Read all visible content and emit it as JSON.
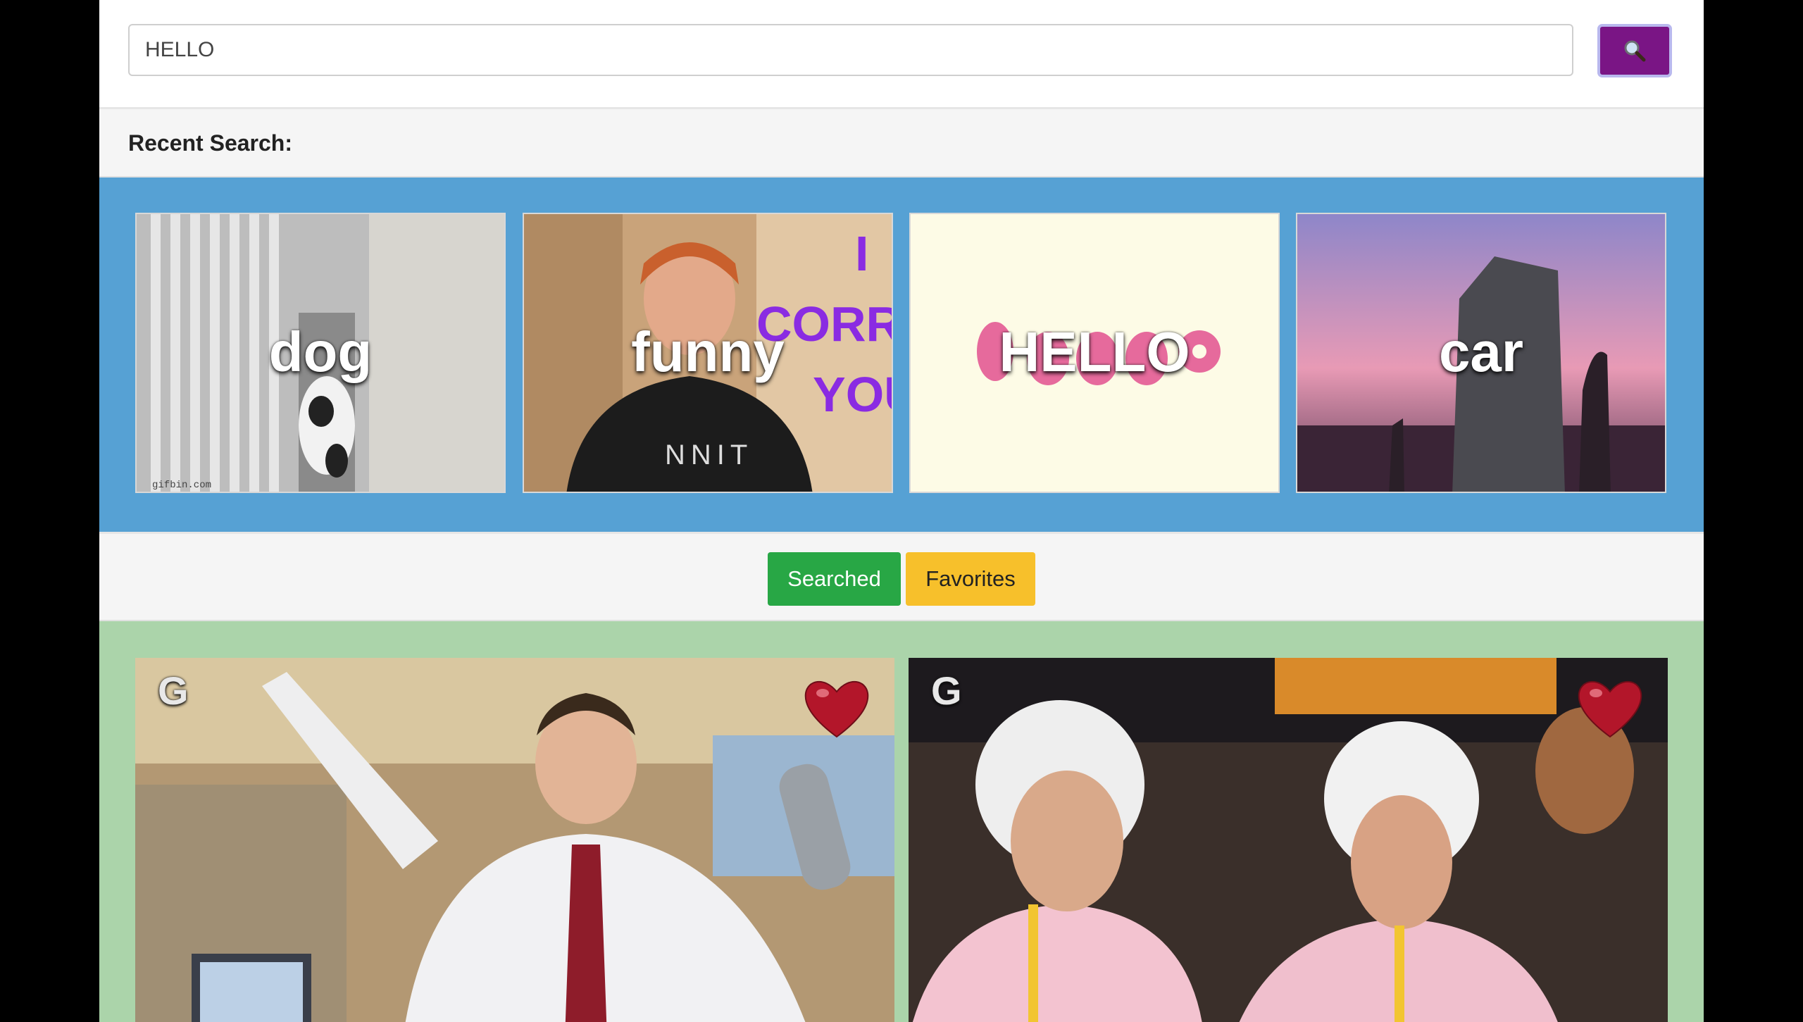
{
  "search": {
    "value": "HELLO",
    "placeholder": "",
    "button_icon": "search-icon"
  },
  "recent": {
    "title": "Recent Search:",
    "items": [
      {
        "label": "dog"
      },
      {
        "label": "funny"
      },
      {
        "label": "HELLO"
      },
      {
        "label": "car"
      }
    ]
  },
  "tabs": [
    {
      "label": "Searched",
      "color": "#28a745",
      "active": true
    },
    {
      "label": "Favorites",
      "color": "#f7c02b",
      "active": false
    }
  ],
  "results": [
    {
      "rating": "G",
      "favorite_icon": "heart-icon"
    },
    {
      "rating": "G",
      "favorite_icon": "heart-icon"
    }
  ],
  "colors": {
    "accent": "#7a1585",
    "recent_bg": "#56a1d4",
    "results_bg": "#abd4aa"
  }
}
